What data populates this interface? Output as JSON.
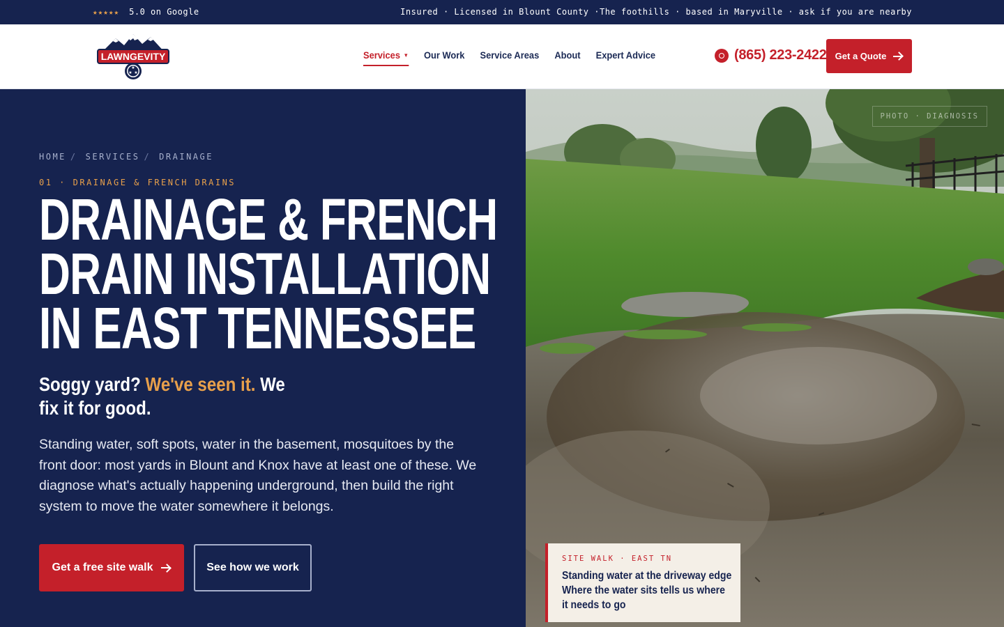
{
  "topbar": {
    "stars": "★★★★★",
    "rating_text": "5.0 on Google",
    "tagline": "Insured · Licensed in Blount County ·The foothills · based in Maryville · ask if you are nearby"
  },
  "header": {
    "logo_text": "LAWNGEVITY",
    "nav": [
      {
        "label": "Services",
        "active": true,
        "has_dropdown": true
      },
      {
        "label": "Our Work"
      },
      {
        "label": "Service Areas"
      },
      {
        "label": "About"
      },
      {
        "label": "Expert Advice"
      }
    ],
    "phone": "(865) 223-2422",
    "cta": "Get a Quote"
  },
  "hero": {
    "breadcrumb": [
      "HOME",
      "SERVICES",
      "DRAINAGE"
    ],
    "eyebrow": "01 · DRAINAGE & FRENCH DRAINS",
    "title_lines": [
      "DRAINAGE & FRENCH",
      "DRAIN INSTALLATION",
      "IN EAST TENNESSEE"
    ],
    "subhead_a": "Soggy yard?",
    "subhead_accent": "We've seen it.",
    "subhead_b": "We fix it for good.",
    "body": "Standing water, soft spots, water in the basement, mosquitoes by the front door: most yards in Blount and Knox have at least one of these. We diagnose what's actually happening underground, then build the right system to move the water somewhere it belongs.",
    "primary_cta": "Get a free site walk",
    "secondary_cta": "See how we work"
  },
  "photo": {
    "tag": "PHOTO · DIAGNOSIS",
    "caption_eyebrow": "SITE WALK · EAST TN",
    "caption_title": "Standing water at the driveway edge Where the water sits tells us where it needs to go"
  },
  "colors": {
    "navy": "#16234f",
    "red": "#c4202a",
    "amber": "#e8a04b",
    "cream": "#f4efe7"
  },
  "icons": [
    "star-icon",
    "phone-icon",
    "chevron-down-icon",
    "arrow-right-icon",
    "logo-mountain-icon"
  ]
}
